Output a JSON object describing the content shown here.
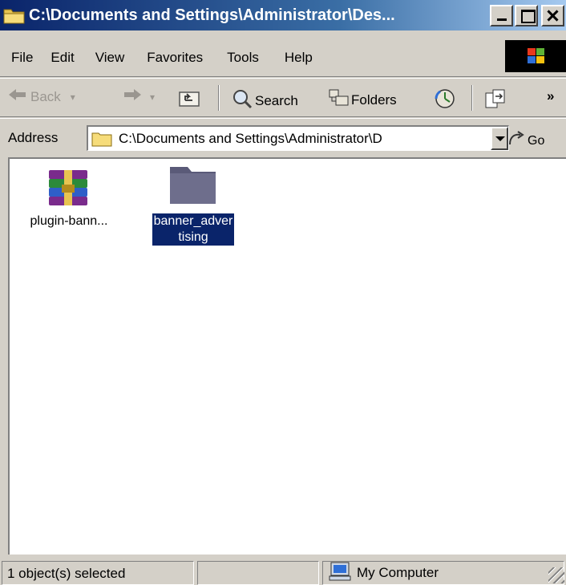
{
  "window": {
    "title": "C:\\Documents and Settings\\Administrator\\Des...",
    "controls": {
      "minimize": "minimize",
      "maximize": "maximize",
      "close": "close"
    }
  },
  "menu": {
    "items": [
      "File",
      "Edit",
      "View",
      "Favorites",
      "Tools",
      "Help"
    ]
  },
  "toolbar": {
    "back_label": "Back",
    "search_label": "Search",
    "folders_label": "Folders",
    "more_label": "»"
  },
  "address": {
    "label": "Address",
    "value": "C:\\Documents and Settings\\Administrator\\D",
    "go_label": "Go"
  },
  "files": [
    {
      "name": "plugin-bann...",
      "icon": "winrar-archive-icon",
      "selected": false
    },
    {
      "name_line1": "banner_adver",
      "name_line2": "tising",
      "icon": "folder-icon",
      "selected": true
    }
  ],
  "status": {
    "selection": "1 object(s) selected",
    "zone": "My Computer"
  },
  "colors": {
    "title_start": "#0a246a",
    "title_end": "#a6caf0",
    "selection": "#0a246a",
    "chrome": "#d4d0c8"
  }
}
